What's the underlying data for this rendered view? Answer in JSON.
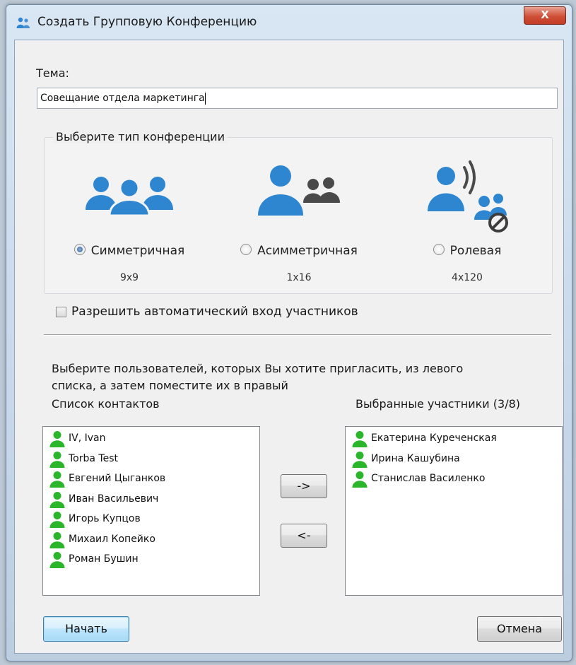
{
  "window": {
    "title": "Создать Групповую Конференцию",
    "close_label": "X"
  },
  "topic": {
    "label": "Тема:",
    "value": "Совещание отдела маркетинга"
  },
  "conference_type": {
    "legend": "Выберите тип конференции",
    "options": [
      {
        "label": "Симметричная",
        "capacity": "9x9",
        "selected": true
      },
      {
        "label": "Асимметричная",
        "capacity": "1x16",
        "selected": false
      },
      {
        "label": "Ролевая",
        "capacity": "4x120",
        "selected": false
      }
    ]
  },
  "auto_join": {
    "label": "Разрешить автоматический вход участников",
    "checked": false
  },
  "instructions": {
    "line1": "Выберите пользователей, которых Вы хотите пригласить, из левого",
    "line2": "списка, а затем поместите их в правый"
  },
  "contacts": {
    "header": "Список контактов",
    "items": [
      "IV, Ivan",
      "Torba Test",
      "Евгений Цыганков",
      "Иван Васильевич",
      "Игорь Купцов",
      "Михаил Копейко",
      "Роман Бушин"
    ]
  },
  "selected": {
    "header": "Выбранные участники (3/8)",
    "items": [
      "Екатерина Куреченская",
      "Ирина Кашубина",
      "Станислав Василенко"
    ]
  },
  "buttons": {
    "add": "->",
    "remove": "<-",
    "start": "Начать",
    "cancel": "Отмена"
  },
  "colors": {
    "user_icon": "#2bb52b",
    "conf_icon_blue": "#2e86d1",
    "conf_icon_gray": "#4a4a4a"
  }
}
